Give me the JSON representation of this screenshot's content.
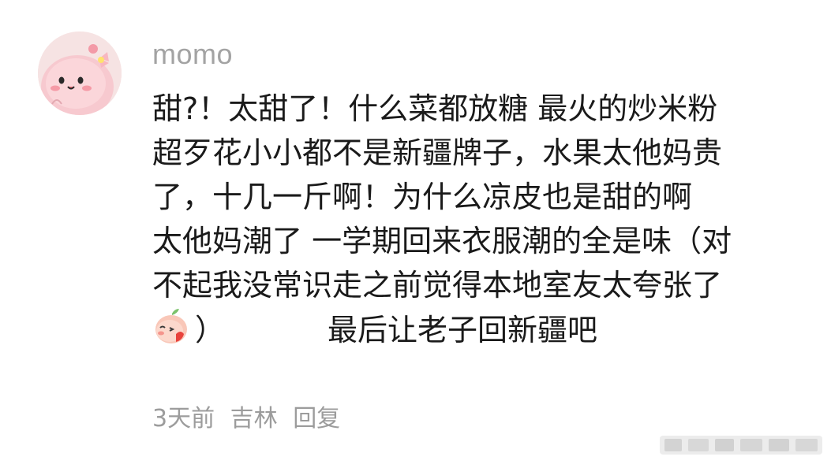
{
  "comment": {
    "username": "momo",
    "lines": [
      "甜?！太甜了！什么菜都放糖  最火的炒米粉",
      "超歹花小小都不是新疆牌子，水果太他妈贵",
      "了，十几一斤啊！为什么凉皮也是甜的啊",
      "太他妈潮了 一学期回来衣服潮的全是味（对",
      "不起我没常识走之前觉得本地室友太夸张了"
    ],
    "last_line_close": "）",
    "last_line_text": "最后让老子回新疆吧",
    "time": "3天前",
    "location": "吉林",
    "reply_label": "回复"
  }
}
